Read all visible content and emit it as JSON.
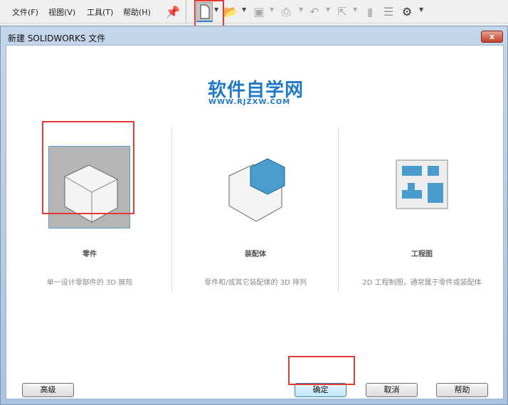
{
  "menu": [
    "文件(F)",
    "视图(V)",
    "工具(T)",
    "帮助(H)"
  ],
  "toolbar": {
    "icons": [
      "pin-icon",
      "new-document-icon",
      "open-icon",
      "save-icon",
      "print-icon",
      "undo-icon",
      "select-icon",
      "traffic-light-icon",
      "options-list-icon",
      "settings-icon"
    ]
  },
  "dialog": {
    "title": "新建 SOLIDWORKS 文件",
    "close": "x",
    "logo": {
      "title": "软件自学网",
      "url": "WWW.RJZXW.COM"
    },
    "options": [
      {
        "label": "零件",
        "desc": "单一设计零部件的 3D 展现"
      },
      {
        "label": "装配体",
        "desc": "零件和/或其它装配体的 3D 排列"
      },
      {
        "label": "工程图",
        "desc": "2D 工程制图，通常属于零件或装配体"
      }
    ],
    "buttons": {
      "advanced": "高级",
      "ok": "确定",
      "cancel": "取消",
      "help": "帮助"
    }
  },
  "colors": {
    "highlight": "#e53935",
    "brand": "#1f78c8"
  }
}
